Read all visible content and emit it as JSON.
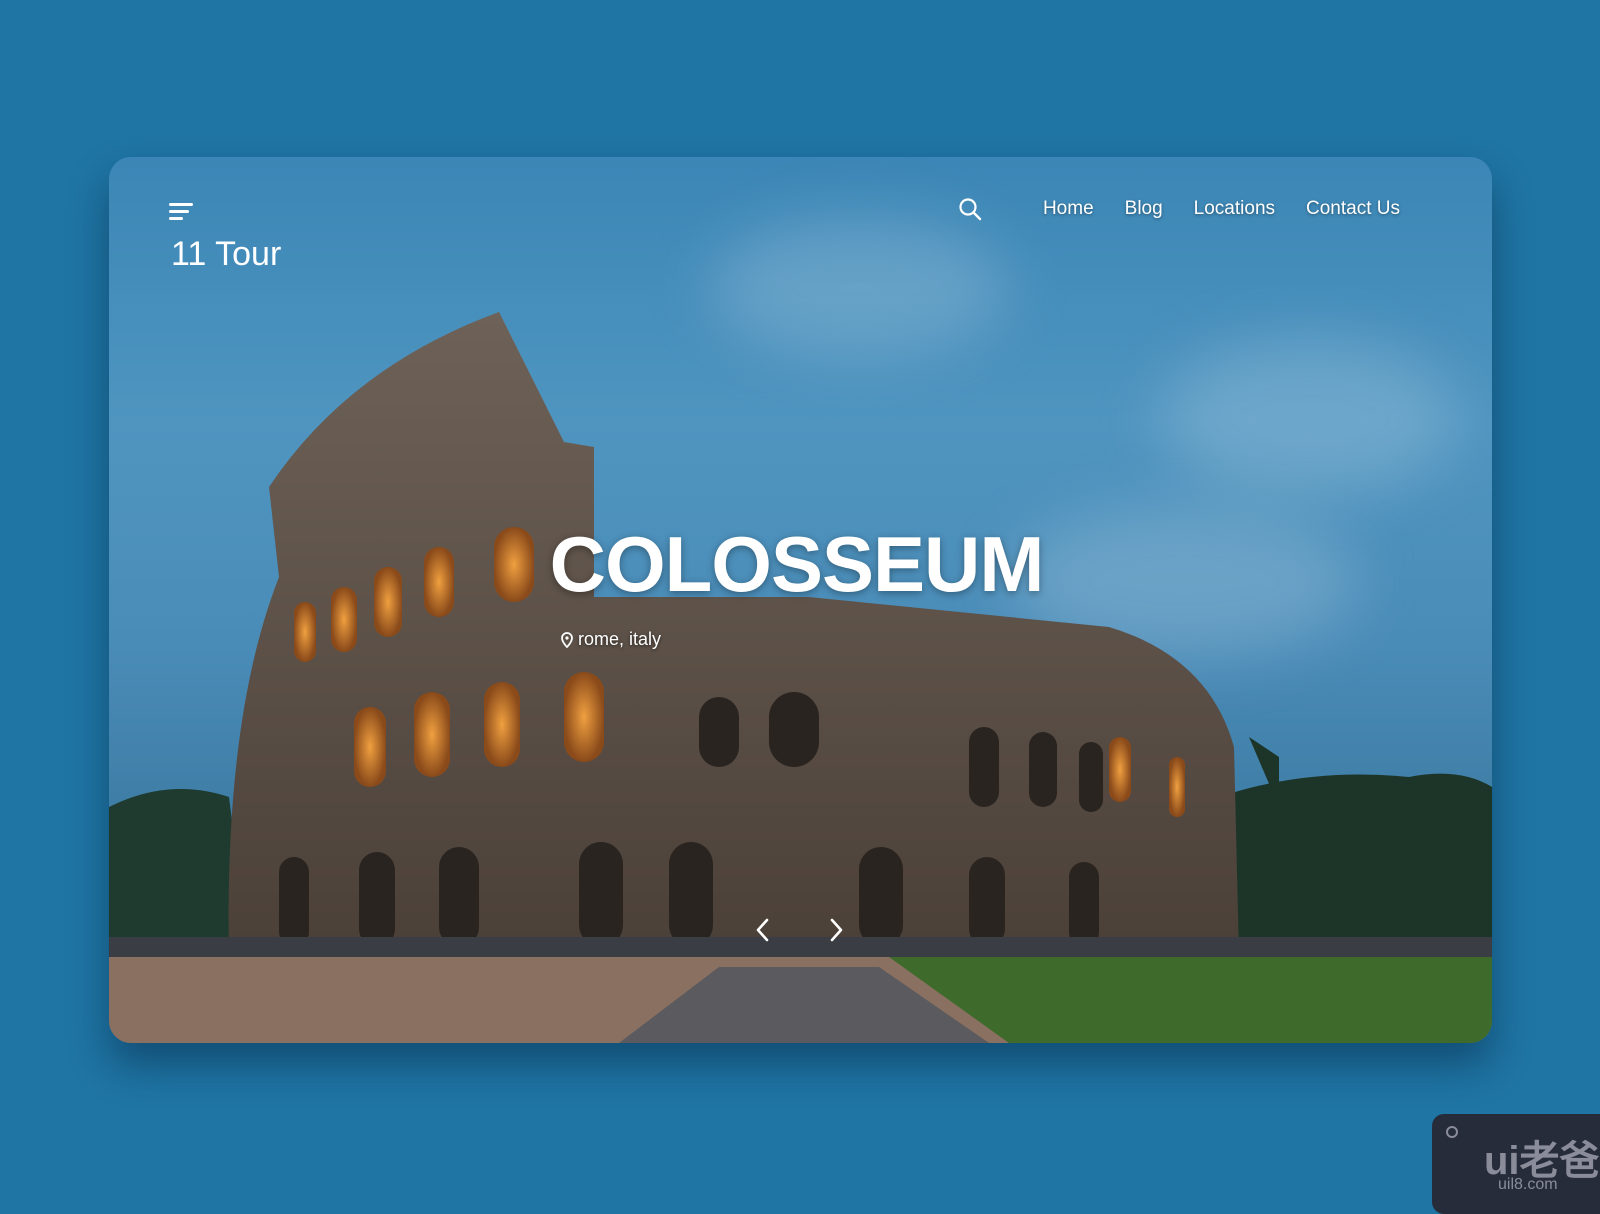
{
  "brand": "11 Tour",
  "nav": {
    "items": [
      {
        "label": "Home"
      },
      {
        "label": "Blog"
      },
      {
        "label": "Locations"
      },
      {
        "label": "Contact Us"
      }
    ]
  },
  "hero": {
    "title": "COLOSSEUM",
    "location": "rome, italy"
  },
  "watermark": {
    "logo": "ui老爸",
    "url": "uil8.com"
  },
  "colors": {
    "background": "#1f75a4",
    "text": "#ffffff"
  }
}
